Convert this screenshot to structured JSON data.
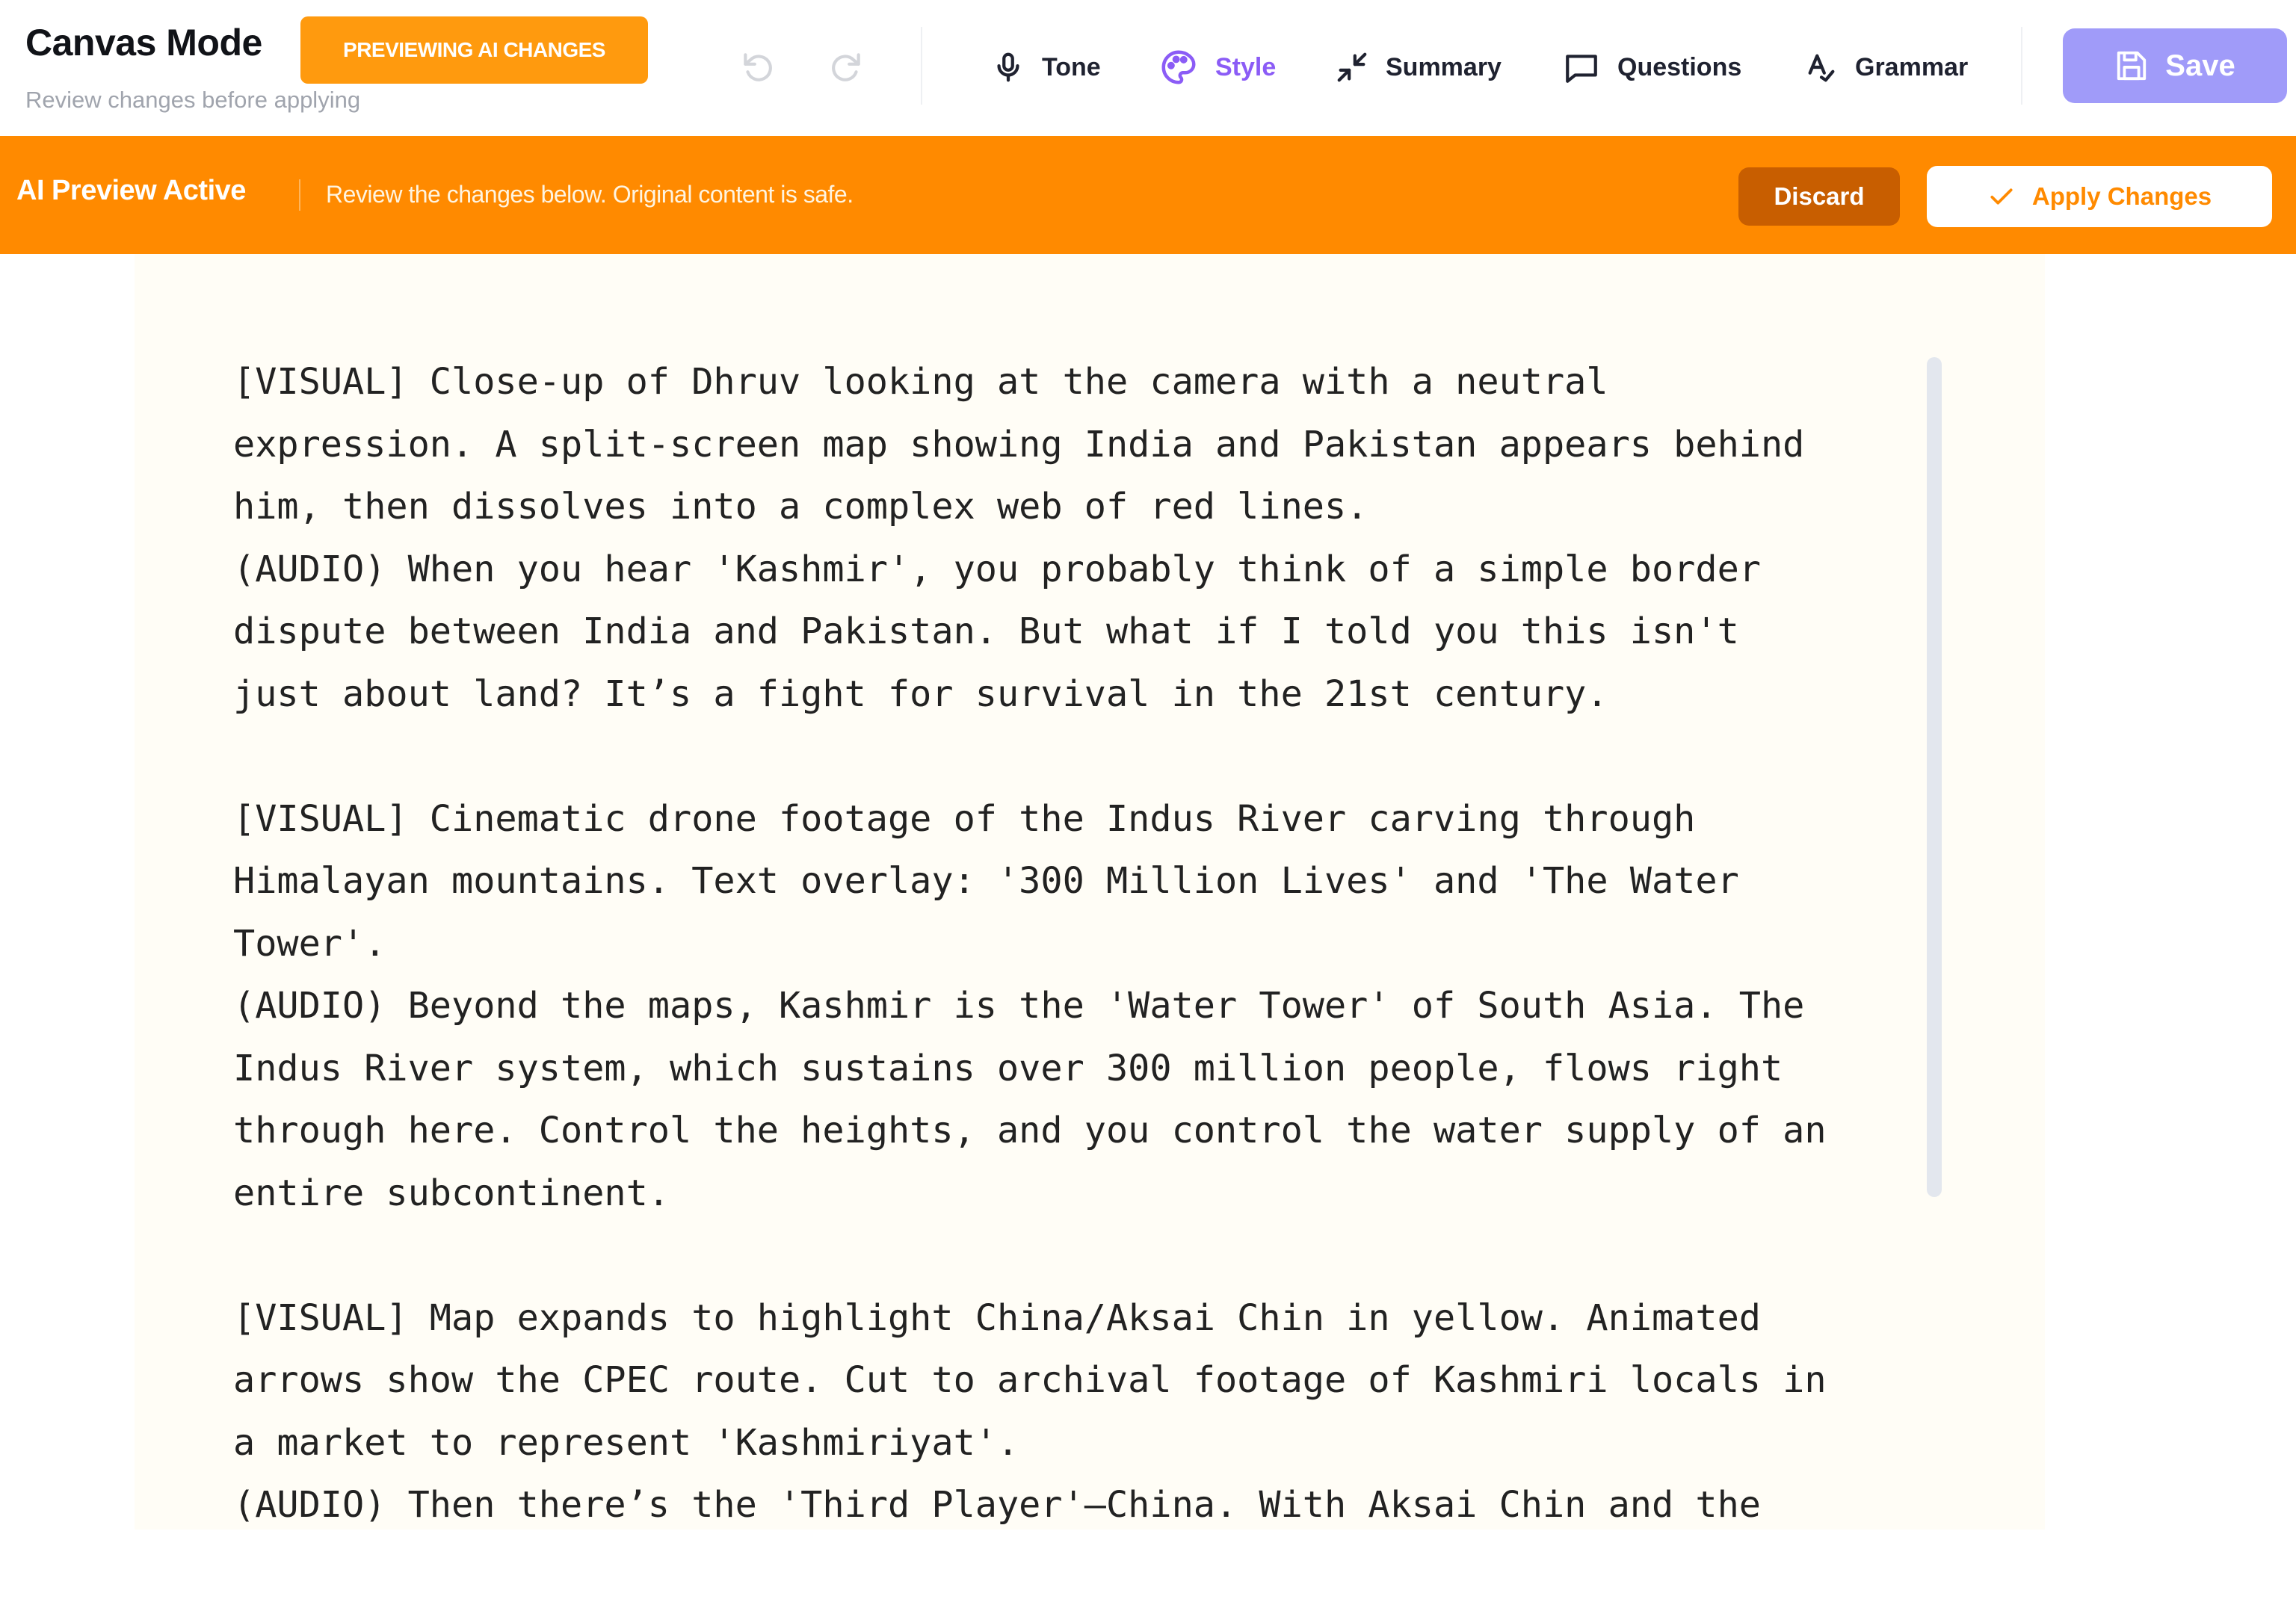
{
  "header": {
    "title": "Canvas Mode",
    "badge": "PREVIEWING AI CHANGES",
    "subtitle": "Review changes before applying",
    "undo_icon": "undo-icon",
    "redo_icon": "redo-icon",
    "tools": [
      {
        "label": "Tone",
        "icon": "microphone-icon",
        "active": false
      },
      {
        "label": "Style",
        "icon": "palette-icon",
        "active": true
      },
      {
        "label": "Summary",
        "icon": "minimize-arrows-icon",
        "active": false
      },
      {
        "label": "Questions",
        "icon": "chat-bubble-icon",
        "active": false
      },
      {
        "label": "Grammar",
        "icon": "spellcheck-icon",
        "active": false
      }
    ],
    "save_label": "Save"
  },
  "banner": {
    "title": "AI Preview Active",
    "message": "Review the changes below. Original content is safe.",
    "discard_label": "Discard",
    "apply_label": "Apply Changes"
  },
  "editor": {
    "paragraphs": [
      {
        "lines": [
          "[VISUAL] Close-up of Dhruv looking at the camera with a neutral",
          "expression. A split-screen map showing India and Pakistan appears behind",
          "him, then dissolves into a complex web of red lines.",
          "(AUDIO) When you hear 'Kashmir', you probably think of a simple border",
          "dispute between India and Pakistan. But what if I told you this isn't",
          "just about land? It’s a fight for survival in the 21st century."
        ]
      },
      {
        "lines": [
          "[VISUAL] Cinematic drone footage of the Indus River carving through",
          "Himalayan mountains. Text overlay: '300 Million Lives' and 'The Water",
          "Tower'.",
          "(AUDIO) Beyond the maps, Kashmir is the 'Water Tower' of South Asia. The",
          "Indus River system, which sustains over 300 million people, flows right",
          "through here. Control the heights, and you control the water supply of an",
          "entire subcontinent."
        ]
      },
      {
        "lines": [
          "[VISUAL] Map expands to highlight China/Aksai Chin in yellow. Animated",
          "arrows show the CPEC route. Cut to archival footage of Kashmiri locals in",
          "a market to represent 'Kashmiriyat'.",
          "(AUDIO) Then there’s the 'Third Player'—China. With Aksai Chin and the"
        ]
      }
    ]
  },
  "colors": {
    "accent_orange": "#ff8a00",
    "badge_orange": "#ff9a0e",
    "discard_brown": "#c85e00",
    "style_purple": "#8b5cf6",
    "save_lavender": "#a09bf9",
    "editor_bg": "#fffdf6"
  }
}
